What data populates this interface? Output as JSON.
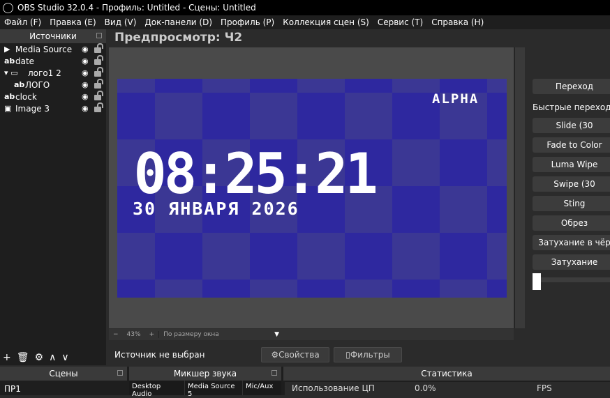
{
  "window": {
    "title": "OBS Studio 32.0.4 - Профиль: Untitled - Сцены: Untitled"
  },
  "menu": [
    "Файл (F)",
    "Правка (E)",
    "Вид (V)",
    "Док-панели (D)",
    "Профиль (P)",
    "Коллекция сцен (S)",
    "Сервис (T)",
    "Справка (H)"
  ],
  "sources": {
    "title": "Источники",
    "items": [
      {
        "icon": "play",
        "label": "Media Source"
      },
      {
        "icon": "ab",
        "label": "date"
      },
      {
        "icon": "folder",
        "label": "лого1 2"
      },
      {
        "icon": "ab",
        "label": "ЛОГО"
      },
      {
        "icon": "ab",
        "label": "clock"
      },
      {
        "icon": "image",
        "label": "Image 3"
      }
    ]
  },
  "preview": {
    "title": "Предпросмотр: Ч2",
    "clock": "08:25:21",
    "date": "30 ЯНВАРЯ 2026",
    "logo": "ALPHA",
    "zoom": "43%",
    "scale_mode": "По размеру окна"
  },
  "context": {
    "no_source": "Источник не выбран",
    "properties": "Свойства",
    "filters": "Фильтры"
  },
  "transitions": {
    "header": "Переход",
    "quick_label": "Быстрые переходы",
    "items": [
      "Slide (30",
      "Fade to Color",
      "Luma Wipe",
      "Swipe (30",
      "Sting",
      "Обрез",
      "Затухание в чёр",
      "Затухание"
    ]
  },
  "bottom": {
    "scenes_title": "Сцены",
    "scene": "ПР1",
    "mixer_title": "Микшер звука",
    "mixer_channels": [
      "Desktop Audio",
      "Media Source 5",
      "Mic/Aux"
    ],
    "stats_title": "Статистика",
    "stats_cpu": "Использование ЦП",
    "stats_cpu_val": "0.0%",
    "stats_fps": "FPS"
  }
}
